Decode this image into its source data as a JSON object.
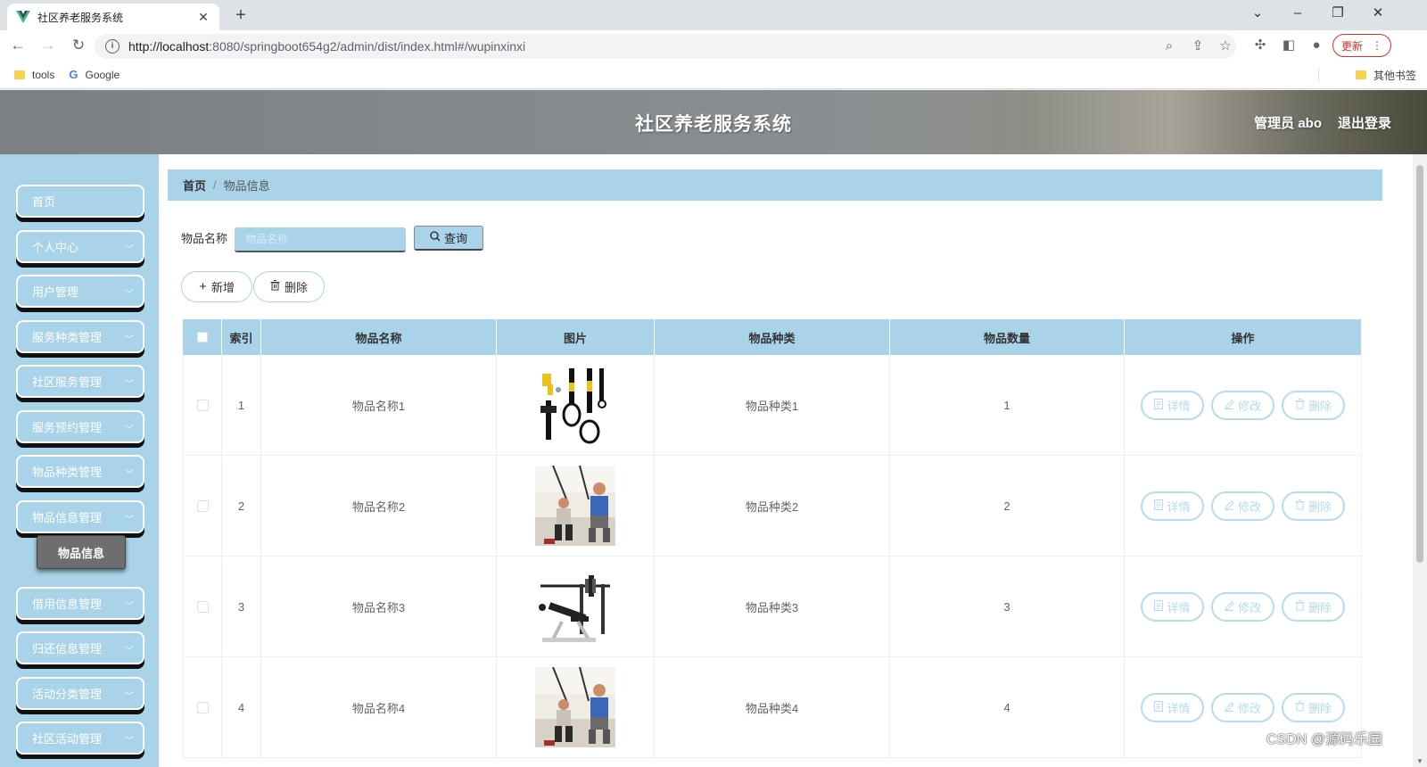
{
  "browser": {
    "tab_title": "社区养老服务系统",
    "url_host": "http://localhost",
    "url_path": ":8080/springboot654g2/admin/dist/index.html#/wupinxinxi",
    "update_label": "更新",
    "bookmarks": [
      {
        "label": "tools",
        "icon": "folder-icon"
      },
      {
        "label": "Google",
        "icon": "google-icon"
      }
    ],
    "other_bookmarks": "其他书签"
  },
  "header": {
    "title": "社区养老服务系统",
    "user": "管理员 abo",
    "logout": "退出登录"
  },
  "sidebar": {
    "items": [
      {
        "label": "首页",
        "has_children": false
      },
      {
        "label": "个人中心",
        "has_children": true
      },
      {
        "label": "用户管理",
        "has_children": true
      },
      {
        "label": "服务种类管理",
        "has_children": true
      },
      {
        "label": "社区服务管理",
        "has_children": true
      },
      {
        "label": "服务预约管理",
        "has_children": true
      },
      {
        "label": "物品种类管理",
        "has_children": true
      },
      {
        "label": "物品信息管理",
        "has_children": true
      },
      {
        "label": "借用信息管理",
        "has_children": true
      },
      {
        "label": "归还信息管理",
        "has_children": true
      },
      {
        "label": "活动分类管理",
        "has_children": true
      },
      {
        "label": "社区活动管理",
        "has_children": true
      }
    ],
    "active_submenu": "物品信息"
  },
  "breadcrumb": {
    "home": "首页",
    "separator": "/",
    "current": "物品信息"
  },
  "search": {
    "label": "物品名称",
    "placeholder": "物品名称",
    "query_button": "查询"
  },
  "actions": {
    "add": "新增",
    "delete": "删除"
  },
  "table": {
    "headers": [
      "索引",
      "物品名称",
      "图片",
      "物品种类",
      "物品数量",
      "操作"
    ],
    "rows": [
      {
        "index": "1",
        "name": "物品名称1",
        "image": "suspension-trainer-straps",
        "category": "物品种类1",
        "quantity": "1"
      },
      {
        "index": "2",
        "name": "物品名称2",
        "image": "people-training-with-straps",
        "category": "物品种类2",
        "quantity": "2"
      },
      {
        "index": "3",
        "name": "物品名称3",
        "image": "weight-bench",
        "category": "物品种类3",
        "quantity": "3"
      },
      {
        "index": "4",
        "name": "物品名称4",
        "image": "people-training-with-straps",
        "category": "物品种类4",
        "quantity": "4"
      }
    ],
    "row_actions": {
      "detail": "详情",
      "edit": "修改",
      "delete": "删除"
    }
  },
  "watermark": "CSDN @源码乐园",
  "colors": {
    "accent": "#a9d3e8",
    "op_button_border": "#b4dcef",
    "submenu_active": "#6e6e6e"
  }
}
